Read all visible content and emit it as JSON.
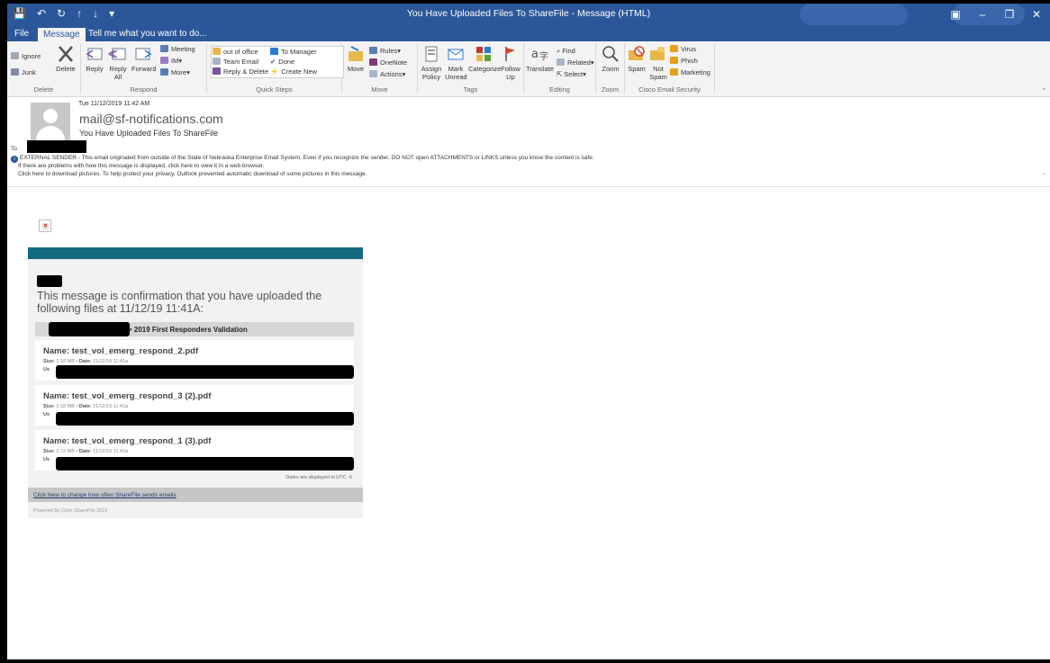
{
  "window": {
    "title": "You Have Uploaded Files To ShareFile - Message (HTML)"
  },
  "tabs": {
    "file": "File",
    "message": "Message",
    "tell_me": "Tell me what you want to do..."
  },
  "ribbon": {
    "delete": {
      "ignore": "Ignore",
      "junk": "Junk",
      "delete": "Delete",
      "label": "Delete"
    },
    "respond": {
      "reply": "Reply",
      "reply_all_1": "Reply",
      "reply_all_2": "All",
      "forward": "Forward",
      "meeting": "Meeting",
      "im": "IM",
      "more": "More",
      "label": "Respond"
    },
    "quick_steps": {
      "out_of_office": "out of office",
      "team_email": "Team Email",
      "reply_delete": "Reply & Delete",
      "to_manager": "To Manager",
      "done": "Done",
      "create_new": "Create New",
      "label": "Quick Steps"
    },
    "move": {
      "move": "Move",
      "rules": "Rules",
      "onenote": "OneNote",
      "actions": "Actions",
      "label": "Move"
    },
    "tags": {
      "assign_1": "Assign",
      "assign_2": "Policy",
      "mark_1": "Mark",
      "mark_2": "Unread",
      "categorize": "Categorize",
      "follow_1": "Follow",
      "follow_2": "Up",
      "label": "Tags"
    },
    "editing": {
      "translate": "Translate",
      "find": "Find",
      "related": "Related",
      "select": "Select",
      "label": "Editing"
    },
    "zoom": {
      "zoom": "Zoom",
      "label": "Zoom"
    },
    "cisco": {
      "spam": "Spam",
      "not_spam_1": "Not",
      "not_spam_2": "Spam",
      "virus": "Virus",
      "phish": "Phish",
      "marketing": "Marketing",
      "label": "Cisco Email Security"
    }
  },
  "header": {
    "date": "Tue 11/12/2019 11:42 AM",
    "from": "mail@sf-notifications.com",
    "subject": "You Have Uploaded Files To ShareFile",
    "to_label": "To",
    "external_notice": "EXTERNAL SENDER - This email originated from outside of the State of Nebraska Enterprise Email System. Even if you recognize the sender, DO NOT open ATTACHMENTS or LINKS unless you know the content is safe.",
    "display_problem": "If there are problems with how this message is displayed, click here to view it in a web browser.",
    "pictures_notice": "Click here to download pictures. To help protect your privacy, Outlook prevented automatic download of some pictures in this message."
  },
  "body": {
    "confirmation": "This message is confirmation that you have uploaded the following files at 11/12/19 11:41A:",
    "folder_path": "> 2019 First Responders Validation",
    "files": [
      {
        "name_label": "Name:",
        "name": "test_vol_emerg_respond_2.pdf",
        "size_label": "Size:",
        "size": "2.18 MB",
        "date_label": "Date:",
        "date": "11/12/19 11:41a",
        "uploader_prefix": "Us"
      },
      {
        "name_label": "Name:",
        "name": "test_vol_emerg_respond_3 (2).pdf",
        "size_label": "Size:",
        "size": "2.18 MB",
        "date_label": "Date:",
        "date": "11/12/19 11:41a",
        "uploader_prefix": "Us"
      },
      {
        "name_label": "Name:",
        "name": "test_vol_emerg_respond_1 (3).pdf",
        "size_label": "Size:",
        "size": "2.19 MB",
        "date_label": "Date:",
        "date": "11/12/19 11:41a",
        "uploader_prefix": "Us"
      }
    ],
    "utc_note": "Dates are displayed in UTC -6",
    "change_link": "Click here to change how often ShareFile sends emails",
    "powered_by": "Powered By Citrix ShareFile 2019"
  }
}
